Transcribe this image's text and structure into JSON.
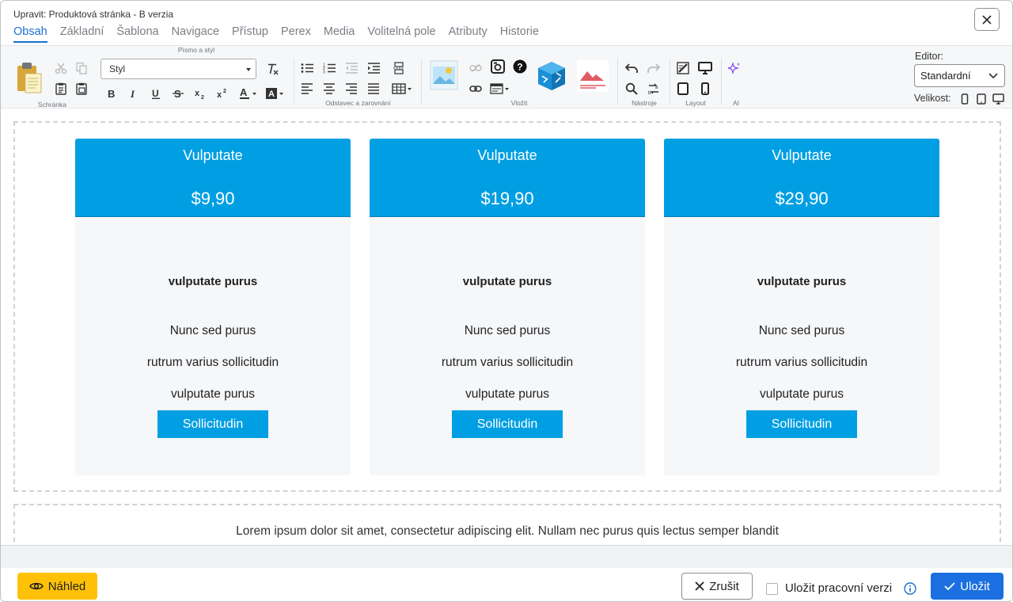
{
  "window": {
    "title": "Upravit: Produktová stránka - B verzia"
  },
  "tabs": [
    {
      "label": "Obsah",
      "active": true
    },
    {
      "label": "Základní"
    },
    {
      "label": "Šablona"
    },
    {
      "label": "Navigace"
    },
    {
      "label": "Přístup"
    },
    {
      "label": "Perex"
    },
    {
      "label": "Media"
    },
    {
      "label": "Volitelná pole"
    },
    {
      "label": "Atributy"
    },
    {
      "label": "Historie"
    }
  ],
  "toolbar": {
    "groups": {
      "clipboard": "Schránka",
      "font": "Písmo a styl",
      "paragraph": "Odstavec a zarovnání",
      "insert": "Vložit",
      "tools": "Nástroje",
      "layout": "Layout",
      "ai": "AI"
    },
    "style_select": "Styl",
    "editor_label": "Editor:",
    "editor_value": "Standardní",
    "size_label": "Velikost:"
  },
  "pricing": [
    {
      "title": "Vulputate",
      "price": "$9,90",
      "feature_title": "vulputate purus",
      "features": [
        "Nunc sed purus",
        "rutrum varius sollicitudin",
        "vulputate purus"
      ],
      "button": "Sollicitudin"
    },
    {
      "title": "Vulputate",
      "price": "$19,90",
      "feature_title": "vulputate purus",
      "features": [
        "Nunc sed purus",
        "rutrum varius sollicitudin",
        "vulputate purus"
      ],
      "button": "Sollicitudin"
    },
    {
      "title": "Vulputate",
      "price": "$29,90",
      "feature_title": "vulputate purus",
      "features": [
        "Nunc sed purus",
        "rutrum varius sollicitudin",
        "vulputate purus"
      ],
      "button": "Sollicitudin"
    }
  ],
  "lorem": "Lorem ipsum dolor sit amet, consectetur adipiscing elit. Nullam nec purus quis lectus semper blandit",
  "footer": {
    "preview": "Náhled",
    "cancel": "Zrušit",
    "save_draft": "Uložit pracovní verzi",
    "save": "Uložit"
  },
  "colors": {
    "accent": "#1b6fd0",
    "card_header": "#009fe3",
    "preview": "#ffc107",
    "save": "#1b6fe0"
  }
}
